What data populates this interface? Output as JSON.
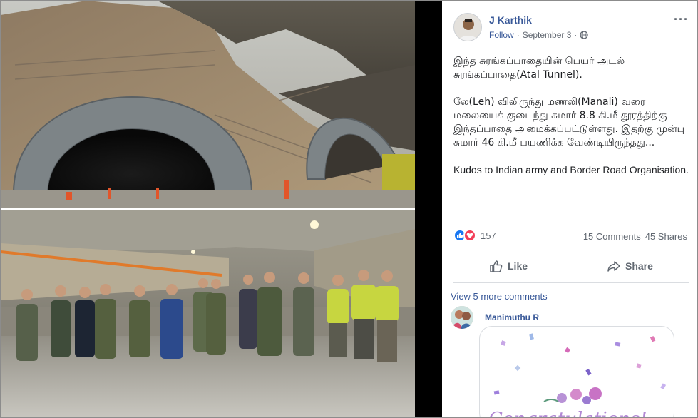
{
  "post": {
    "author": "J Karthik",
    "follow_label": "Follow",
    "separator": "·",
    "date": "September 3",
    "separator2": "·",
    "more_label": "···",
    "text_line_1": "இந்த சுரங்கப்பாதையின் பெயர் அடல் சுரங்கப்பாதை(Atal Tunnel).",
    "text_line_2": "லே(Leh) விலிருந்து மணலி(Manali) வரை மலையைக் குடைந்து சுமார் 8.8 கி.மீ தூரத்திற்கு இந்தப்பாதை அமைக்கப்பட்டுள்ளது. இதற்கு முன்பு சுமார் 46 கி.மீ பயணிக்க வேண்டியிருந்தது...",
    "text_line_3": "Kudos to Indian army and Border Road Organisation."
  },
  "engagement": {
    "reaction_count": "157",
    "comments": "15 Comments",
    "shares": "45 Shares"
  },
  "actions": {
    "like_label": "Like",
    "share_label": "Share"
  },
  "comments": {
    "view_more": "View 5 more comments",
    "first_commenter": "Manimuthu R",
    "sticker_text": "Congratulations!"
  },
  "colors": {
    "link_blue": "#385898",
    "like_blue": "#1877f2",
    "love_red": "#f33e58",
    "text_gray": "#606770"
  },
  "icons": [
    "globe-icon",
    "like-reaction-icon",
    "love-reaction-icon",
    "thumbs-up-icon",
    "share-arrow-icon",
    "more-options-icon"
  ]
}
